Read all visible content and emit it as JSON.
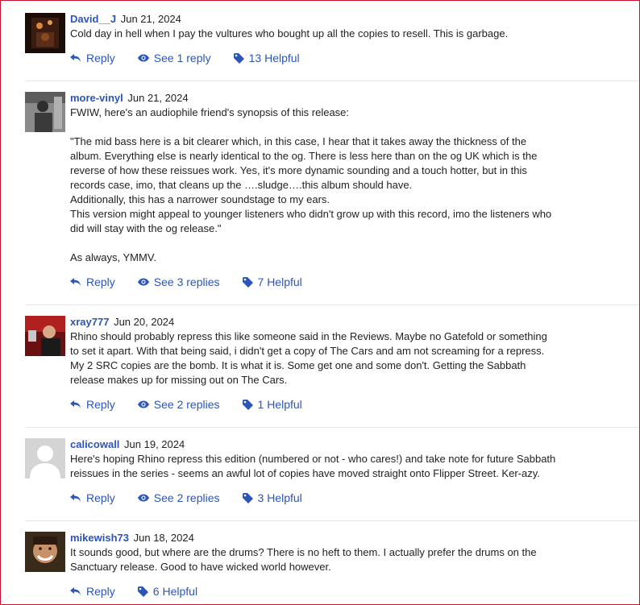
{
  "comments": [
    {
      "user": "David__J",
      "date": "Jun 21, 2024",
      "text": [
        "Cold day in hell when I pay the vultures who bought up all the copies to resell. This is garbage."
      ],
      "reply": "Reply",
      "see_replies": "See 1 reply",
      "helpful": "13 Helpful"
    },
    {
      "user": "more-vinyl",
      "date": "Jun 21, 2024",
      "text": [
        "FWIW, here's an audiophile friend's synopsis of this release:",
        "",
        "\"The mid bass here is a bit clearer which, in this case, I hear that it takes away the thickness of the",
        "album. Everything else is nearly identical to the og. There is less here than on the og UK which is the",
        "reverse of how these reissues work. Yes, it's more dynamic sounding and a touch hotter, but in this",
        "records case, imo, that cleans up the ….sludge….this album should have.",
        "Additionally, this has a narrower soundstage to my ears.",
        "This version might appeal to younger listeners who didn't grow up with this record, imo the listeners who",
        "did will stay with the og release.\"",
        "",
        "As always, YMMV."
      ],
      "reply": "Reply",
      "see_replies": "See 3 replies",
      "helpful": "7 Helpful"
    },
    {
      "user": "xray777",
      "date": "Jun 20, 2024",
      "text": [
        "Rhino should probably repress this like someone said in the Reviews. Maybe no Gatefold or something",
        "to set it apart. With that being said, i didn't get a copy of The Cars and am not screaming for a repress.",
        "My 2 SRC copies are the bomb. It is what it is. Some get one and some don't. Getting the Sabbath",
        "release makes up for missing out on The Cars."
      ],
      "reply": "Reply",
      "see_replies": "See 2 replies",
      "helpful": "1 Helpful"
    },
    {
      "user": "calicowall",
      "date": "Jun 19, 2024",
      "text": [
        "Here's hoping Rhino repress this edition (numbered or not - who cares!) and take note for future Sabbath",
        "reissues in the series - seems an awful lot of copies have moved straight onto Flipper Street. Ker-azy."
      ],
      "reply": "Reply",
      "see_replies": "See 2 replies",
      "helpful": "3 Helpful"
    },
    {
      "user": "mikewish73",
      "date": "Jun 18, 2024",
      "text": [
        "It sounds good, but where are the drums? There is no heft to them. I actually prefer the drums on the",
        "Sanctuary release. Good to have wicked world however."
      ],
      "reply": "Reply",
      "helpful": "6 Helpful"
    }
  ],
  "colors": {
    "link": "#2c55b8",
    "frame": "#c8102e",
    "divider": "#e6e6e6"
  }
}
